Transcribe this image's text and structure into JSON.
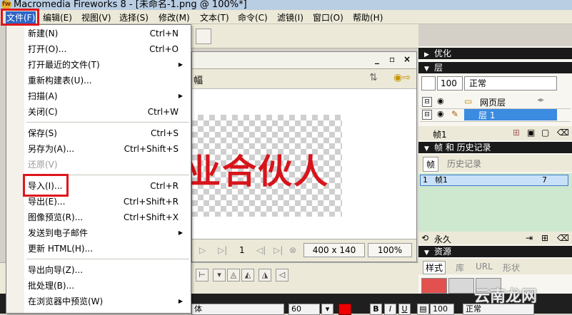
{
  "window": {
    "title": "Macromedia Fireworks 8 - [未命名-1.png @ 100%*]",
    "app_icon": "fireworks-app-icon"
  },
  "menubar": [
    {
      "label": "文件(F)",
      "active": true
    },
    {
      "label": "编辑(E)"
    },
    {
      "label": "视图(V)"
    },
    {
      "label": "选择(S)"
    },
    {
      "label": "修改(M)"
    },
    {
      "label": "文本(T)"
    },
    {
      "label": "命令(C)"
    },
    {
      "label": "滤镜(I)"
    },
    {
      "label": "窗口(O)"
    },
    {
      "label": "帮助(H)"
    }
  ],
  "file_menu": {
    "items": [
      {
        "label": "新建(N)",
        "shortcut": "Ctrl+N"
      },
      {
        "label": "打开(O)...",
        "shortcut": "Ctrl+O"
      },
      {
        "label": "打开最近的文件(T)",
        "submenu": true
      },
      {
        "label": "重新构建表(U)..."
      },
      {
        "label": "扫描(A)",
        "submenu": true
      },
      {
        "label": "关闭(C)",
        "shortcut": "Ctrl+W"
      },
      {
        "label": "保存(S)",
        "shortcut": "Ctrl+S"
      },
      {
        "label": "另存为(A)...",
        "shortcut": "Ctrl+Shift+S"
      },
      {
        "label": "还原(V)",
        "disabled": true
      },
      {
        "label": "导入(I)...",
        "shortcut": "Ctrl+R",
        "highlighted": true
      },
      {
        "label": "导出(E)...",
        "shortcut": "Ctrl+Shift+R"
      },
      {
        "label": "图像预览(R)...",
        "shortcut": "Ctrl+Shift+X"
      },
      {
        "label": "发送到电子邮件",
        "submenu": true
      },
      {
        "label": "更新 HTML(H)..."
      },
      {
        "label": "导出向导(Z)..."
      },
      {
        "label": "批处理(B)..."
      },
      {
        "label": "在浏览器中预览(W)",
        "submenu": true
      }
    ]
  },
  "document": {
    "window_controls": [
      "_",
      "▫",
      "×"
    ],
    "canvas_text": "业合伙人",
    "tab_label": "幅",
    "frame_number": "1",
    "size": "400 x 140",
    "zoom": "100%"
  },
  "panels": {
    "optimize": "优化",
    "layers": {
      "header": "层",
      "opacity": "100",
      "blend": "正常",
      "rows": [
        {
          "name": "网页层",
          "selected": false
        },
        {
          "name": "层 1",
          "selected": true
        }
      ],
      "footer_frame": "帧1"
    },
    "frames_history": {
      "header": "帧 和 历史记录",
      "tab_frames": "帧",
      "tab_history": "历史记录",
      "frame_row": {
        "index": "1",
        "name": "帧1",
        "delay": "7"
      },
      "loop_label": "永久"
    },
    "assets": {
      "header": "资源",
      "tabs": [
        "样式",
        "库",
        "URL",
        "形状"
      ]
    }
  },
  "properties": {
    "font_name": "体",
    "font_size": "60",
    "text_color": "#e00000",
    "bold": "B",
    "italic": "I",
    "underline": "U",
    "opacity": "100",
    "blend": "正常"
  },
  "watermark": "云南龙网"
}
